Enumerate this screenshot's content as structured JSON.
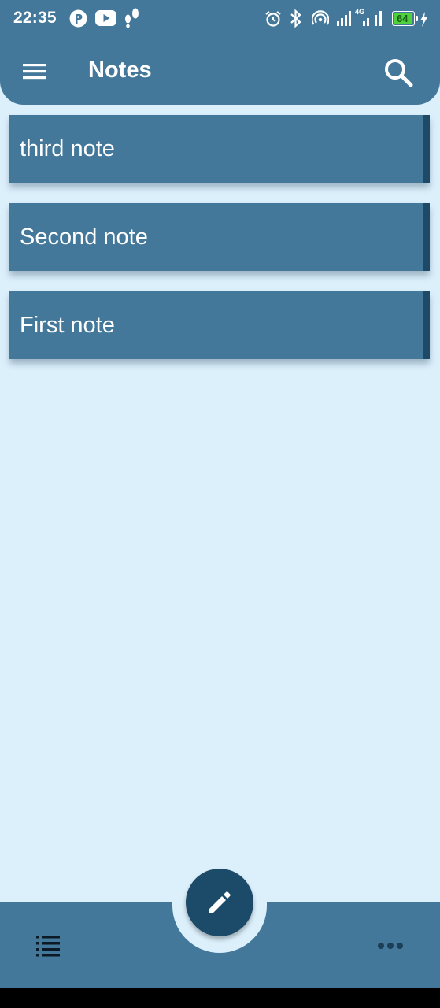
{
  "status_bar": {
    "time": "22:35",
    "left_icons": [
      "p-app-icon",
      "youtube-icon",
      "footprints-icon"
    ],
    "right_icons": [
      "alarm-icon",
      "bluetooth-icon",
      "hotspot-icon",
      "signal-icon",
      "signal-4g-icon",
      "signal-icon-2"
    ],
    "network_label": "4G",
    "battery_level": "64",
    "battery_charging": true
  },
  "app_bar": {
    "title": "Notes",
    "menu_icon": "hamburger-menu-icon",
    "search_icon": "search-icon"
  },
  "notes": [
    {
      "title": "third note"
    },
    {
      "title": "Second note"
    },
    {
      "title": "First note"
    }
  ],
  "bottom_bar": {
    "fab_icon": "pencil-icon",
    "left_icon": "list-icon",
    "right_icon": "more-dots-icon"
  },
  "colors": {
    "primary": "#43789a",
    "primary_dark": "#1c4a69",
    "background": "#dcf0fc",
    "on_primary": "#ffffff"
  }
}
